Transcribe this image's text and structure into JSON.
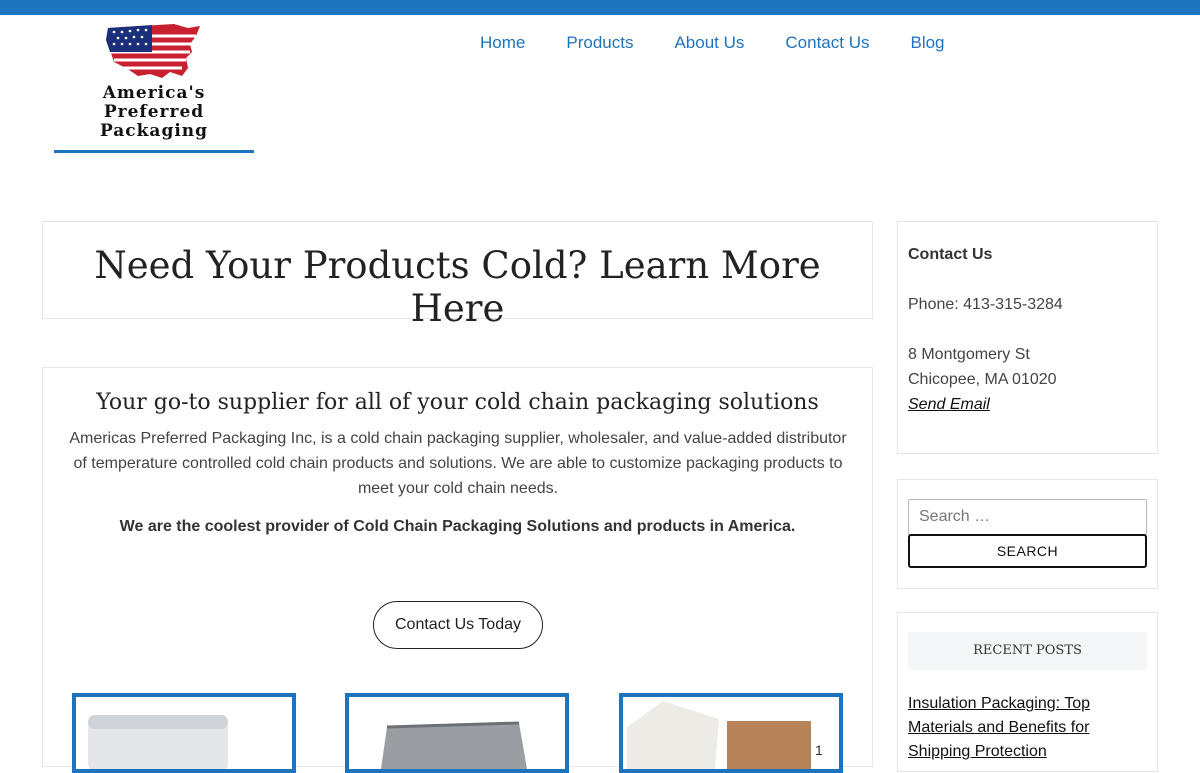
{
  "brand": {
    "logo_lines": [
      "America's",
      "Preferred",
      "Packaging"
    ],
    "accent_color": "#1e73be"
  },
  "nav": {
    "items": [
      "Home",
      "Products",
      "About Us",
      "Contact Us",
      "Blog"
    ]
  },
  "hero": {
    "title": "Need Your Products Cold? Learn More Here"
  },
  "main": {
    "heading": "Your go-to supplier for all of your cold chain packaging solutions",
    "intro": "Americas Preferred Packaging Inc, is a cold chain packaging supplier, wholesaler, and value-added distributor of temperature controlled cold chain products and solutions. We are able to customize packaging products to meet your cold chain needs.",
    "tagline": "We are the coolest provider of Cold Chain Packaging Solutions and products in America.",
    "cta_label": "Contact Us Today"
  },
  "sidebar": {
    "contact": {
      "title": "Contact Us",
      "phone": "Phone: 413-315-3284",
      "address_line1": "8 Montgomery St",
      "address_line2": "Chicopee, MA 01020",
      "email_link": "Send Email"
    },
    "search": {
      "placeholder": "Search …",
      "button_label": "SEARCH"
    },
    "recent_posts": {
      "title": "RECENT POSTS",
      "first_post": "Insulation Packaging: Top Materials and Benefits for Shipping Protection"
    }
  }
}
